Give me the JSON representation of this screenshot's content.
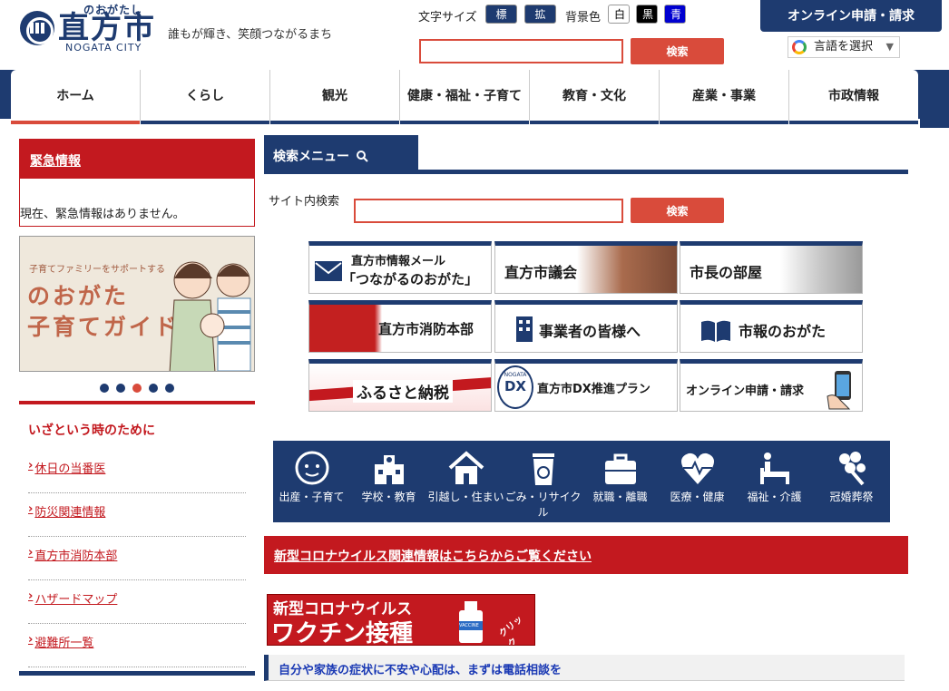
{
  "header": {
    "logo_ruby": "のおがたし",
    "logo_name": "直方市",
    "logo_en": "NOGATA CITY",
    "tagline": "誰もが輝き、笑顔つながるまち",
    "font_size_label": "文字サイズ",
    "font_standard": "標準",
    "font_large": "拡大",
    "bg_label": "背景色",
    "bg_white": "白",
    "bg_black": "黒",
    "bg_blue": "青",
    "search_button": "検索",
    "online_button": "オンライン申請・請求",
    "language_select": "言語を選択"
  },
  "nav": {
    "items": [
      "ホーム",
      "くらし",
      "観光",
      "健康・福祉・子育て",
      "教育・文化",
      "産業・事業",
      "市政情報"
    ],
    "active": "ホーム"
  },
  "sidebar": {
    "emergency_title": "緊急情報",
    "emergency_text": "現在、緊急情報はありません。",
    "banner_small": "子育てファミリーをサポートする",
    "banner_line1": "のおがた",
    "banner_line2": "子育てガイド",
    "safety_title": "いざという時のために",
    "safety_items": [
      "休日の当番医",
      "防災関連情報",
      "直方市消防本部",
      "ハザードマップ",
      "避難所一覧"
    ]
  },
  "search_menu": {
    "title": "検索メニュー",
    "site_search_label": "サイト内検索",
    "search_button": "検索"
  },
  "tiles": {
    "mail_line1": "直方市情報メール",
    "mail_line2": "「つながるのおがた」",
    "council": "直方市議会",
    "mayor": "市長の部屋",
    "fire": "直方市消防本部",
    "business": "事業者の皆様へ",
    "newsletter": "市報のおがた",
    "furusato": "ふるさと納税",
    "dx_logo_top": "NOGATA",
    "dx_logo": "DX",
    "dx": "直方市DX推進プラン",
    "online": "オンライン申請・請求"
  },
  "categories": [
    "出産・子育て",
    "学校・教育",
    "引越し・住まい",
    "ごみ・リサイクル",
    "就職・離職",
    "医療・健康",
    "福祉・介護",
    "冠婚葬祭"
  ],
  "covid_link": "新型コロナウイルス関連情報はこちらからご覧ください",
  "vaccine_banner": {
    "line1": "新型コロナウイルス",
    "line2": "ワクチン接種",
    "click": "クリック",
    "bottle_label": "VACCINE"
  },
  "consult_notice": "自分や家族の症状に不安や心配は、まずは電話相談を",
  "carousel": {
    "count": 5,
    "active_index": 2
  },
  "colors": {
    "navy": "#1e3b70",
    "red": "#c3191f",
    "accent": "#d94b3b"
  }
}
